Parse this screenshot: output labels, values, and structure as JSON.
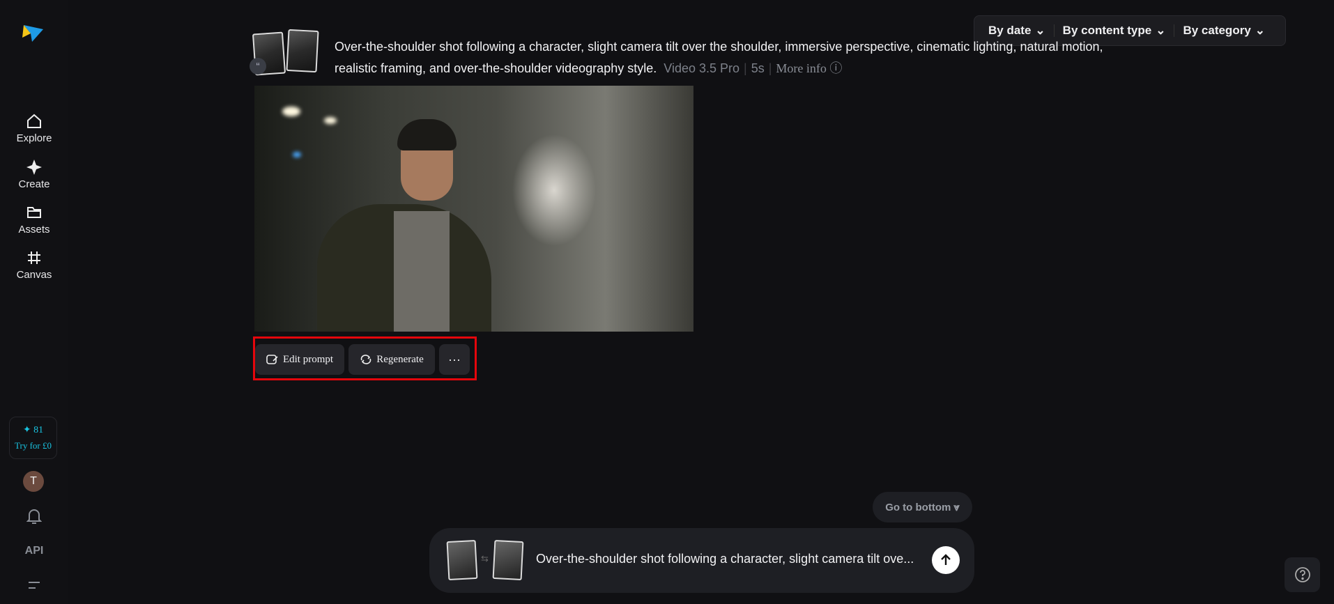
{
  "sidebar": {
    "nav": [
      {
        "label": "Explore",
        "icon": "home-icon"
      },
      {
        "label": "Create",
        "icon": "sparkle-icon"
      },
      {
        "label": "Assets",
        "icon": "folder-icon"
      },
      {
        "label": "Canvas",
        "icon": "crop-icon"
      }
    ],
    "credits": {
      "count": "81",
      "offer": "Try for £0"
    },
    "avatar_initial": "T",
    "api_label": "API"
  },
  "filters": [
    "By date",
    "By content type",
    "By category"
  ],
  "generation": {
    "prompt": "Over-the-shoulder shot following a character, slight camera tilt over the shoulder, immersive perspective, cinematic lighting, natural motion, realistic framing, and over-the-shoulder videography style.",
    "model": "Video 3.5 Pro",
    "duration": "5s",
    "more_info": "More info"
  },
  "actions": {
    "edit": "Edit prompt",
    "regenerate": "Regenerate"
  },
  "go_to_bottom": "Go to bottom",
  "input": {
    "text": "Over-the-shoulder shot following a character, slight camera tilt ove..."
  },
  "colors": {
    "accent": "#19c3e0",
    "highlight": "#e5060c"
  }
}
